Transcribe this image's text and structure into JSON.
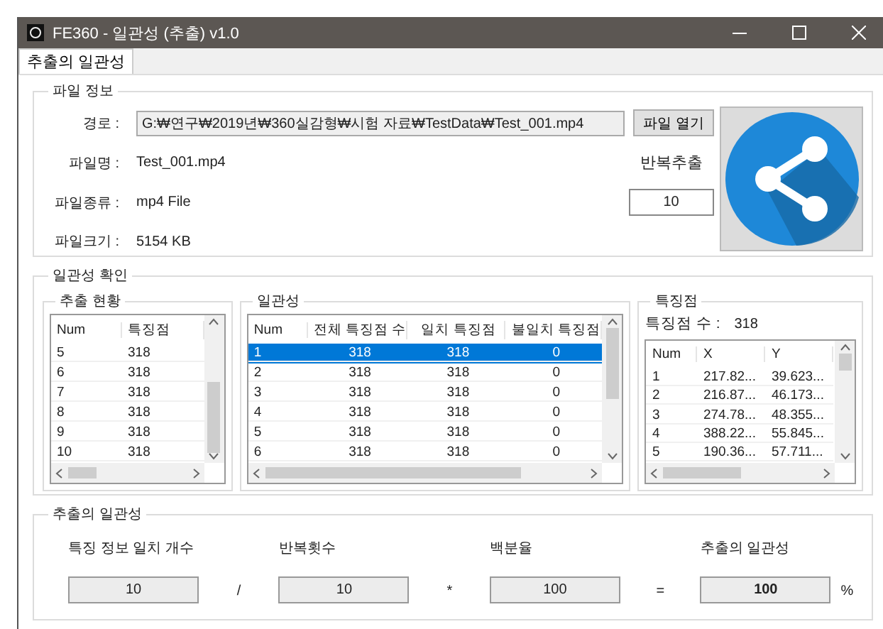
{
  "window": {
    "title": "FE360 - 일관성 (추출) v1.0"
  },
  "tabs": [
    {
      "label": "추출의 일관성",
      "selected": true
    }
  ],
  "file_info": {
    "title": "파일 정보",
    "path_label": "경로 :",
    "path": "G:₩연구₩2019년₩360실감형₩시험 자료₩TestData₩Test_001.mp4",
    "open_button": "파일 열기",
    "name_label": "파일명 :",
    "name": "Test_001.mp4",
    "type_label": "파일종류 :",
    "type": "mp4 File",
    "size_label": "파일크기 :",
    "size": "5154 KB",
    "repeat_label": "반복추출",
    "repeat": "10"
  },
  "check": {
    "title": "일관성 확인",
    "extraction": {
      "title": "추출 현황",
      "columns": [
        "Num",
        "특징점"
      ],
      "rows": [
        {
          "cells": [
            "5",
            "318"
          ],
          "selected": false
        },
        {
          "cells": [
            "6",
            "318"
          ],
          "selected": false
        },
        {
          "cells": [
            "7",
            "318"
          ],
          "selected": false
        },
        {
          "cells": [
            "8",
            "318"
          ],
          "selected": false
        },
        {
          "cells": [
            "9",
            "318"
          ],
          "selected": false
        },
        {
          "cells": [
            "10",
            "318"
          ],
          "selected": false
        }
      ]
    },
    "consistency": {
      "title": "일관성",
      "columns": [
        "Num",
        "전체 특징점 수",
        "일치 특징점",
        "불일치 특징점"
      ],
      "rows": [
        {
          "cells": [
            "1",
            "318",
            "318",
            "0"
          ],
          "selected": true
        },
        {
          "cells": [
            "2",
            "318",
            "318",
            "0"
          ],
          "selected": false
        },
        {
          "cells": [
            "3",
            "318",
            "318",
            "0"
          ],
          "selected": false
        },
        {
          "cells": [
            "4",
            "318",
            "318",
            "0"
          ],
          "selected": false
        },
        {
          "cells": [
            "5",
            "318",
            "318",
            "0"
          ],
          "selected": false
        },
        {
          "cells": [
            "6",
            "318",
            "318",
            "0"
          ],
          "selected": false
        }
      ]
    },
    "features": {
      "title": "특징점",
      "count_label": "특징점 수 :",
      "count": "318",
      "columns": [
        "Num",
        "X",
        "Y"
      ],
      "rows": [
        {
          "cells": [
            "1",
            "217.82...",
            "39.623..."
          ],
          "selected": false
        },
        {
          "cells": [
            "2",
            "216.87...",
            "46.173..."
          ],
          "selected": false
        },
        {
          "cells": [
            "3",
            "274.78...",
            "48.355..."
          ],
          "selected": false
        },
        {
          "cells": [
            "4",
            "388.22...",
            "55.845..."
          ],
          "selected": false
        },
        {
          "cells": [
            "5",
            "190.36...",
            "57.711..."
          ],
          "selected": false
        }
      ]
    }
  },
  "result": {
    "title": "추출의 일관성",
    "items": [
      {
        "label": "특징 정보 일치 개수",
        "value": "10",
        "operator": "/"
      },
      {
        "label": "반복횟수",
        "value": "10",
        "operator": "*"
      },
      {
        "label": "백분율",
        "value": "100",
        "operator": "="
      },
      {
        "label": "추출의 일관성",
        "value": "100",
        "operator": "%"
      }
    ]
  }
}
